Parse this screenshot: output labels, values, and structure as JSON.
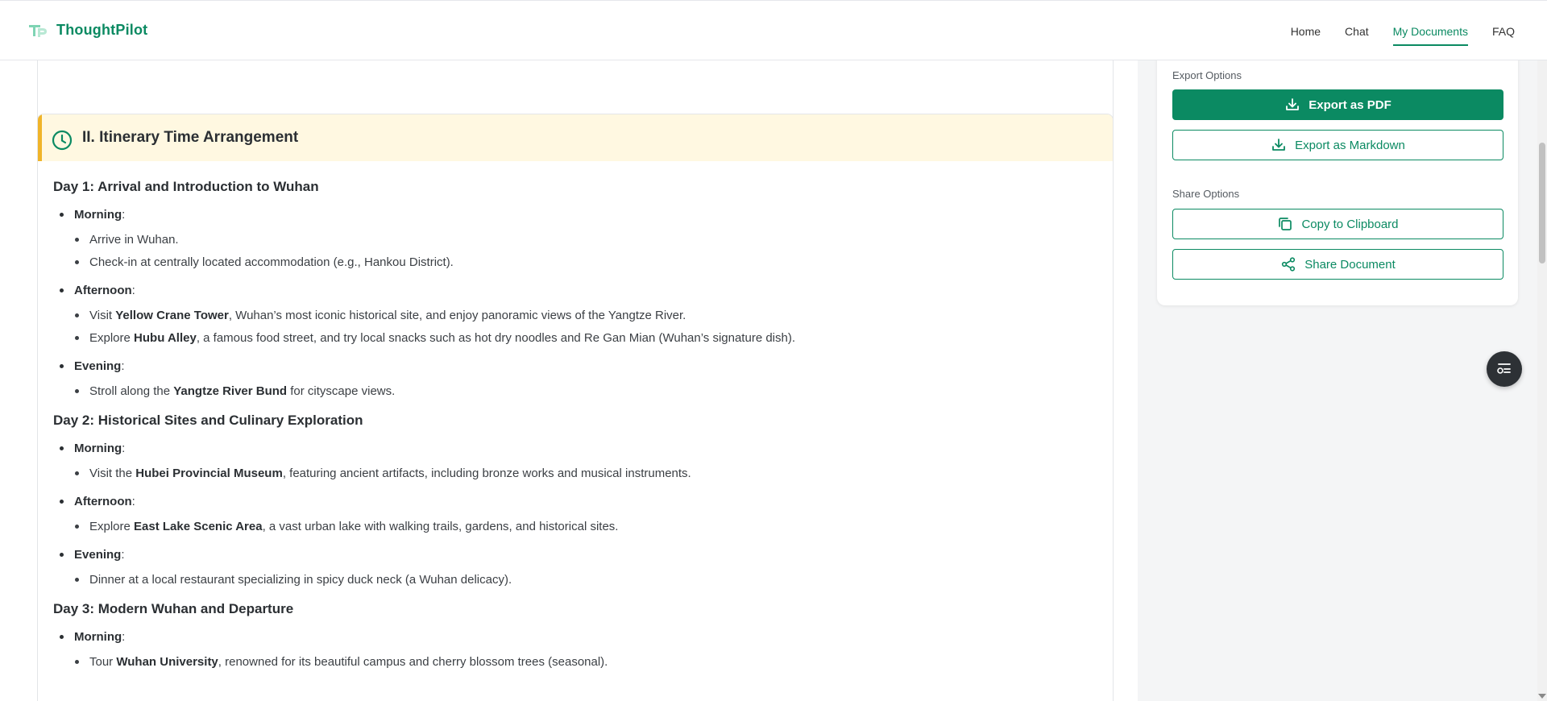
{
  "brand": {
    "name": "ThoughtPilot"
  },
  "nav": {
    "items": [
      "Home",
      "Chat",
      "My Documents",
      "FAQ"
    ],
    "active": "My Documents"
  },
  "section": {
    "title": "II. Itinerary Time Arrangement",
    "days": [
      {
        "title": "Day 1: Arrival and Introduction to Wuhan",
        "morning_label": "Morning",
        "morning": [
          "Arrive in Wuhan.",
          "Check-in at centrally located accommodation (e.g., Hankou District)."
        ],
        "afternoon_label": "Afternoon",
        "afternoon_1_pre": "Visit ",
        "afternoon_1_bold": "Yellow Crane Tower",
        "afternoon_1_post": ", Wuhan’s most iconic historical site, and enjoy panoramic views of the Yangtze River.",
        "afternoon_2_pre": "Explore ",
        "afternoon_2_bold": "Hubu Alley",
        "afternoon_2_post": ", a famous food street, and try local snacks such as hot dry noodles and Re Gan Mian (Wuhan’s signature dish).",
        "evening_label": "Evening",
        "evening_1_pre": "Stroll along the ",
        "evening_1_bold": "Yangtze River Bund",
        "evening_1_post": " for cityscape views."
      },
      {
        "title": "Day 2: Historical Sites and Culinary Exploration",
        "morning_label": "Morning",
        "morning_1_pre": "Visit the ",
        "morning_1_bold": "Hubei Provincial Museum",
        "morning_1_post": ", featuring ancient artifacts, including bronze works and musical instruments.",
        "afternoon_label": "Afternoon",
        "afternoon_1_pre": "Explore ",
        "afternoon_1_bold": "East Lake Scenic Area",
        "afternoon_1_post": ", a vast urban lake with walking trails, gardens, and historical sites.",
        "evening_label": "Evening",
        "evening_1": "Dinner at a local restaurant specializing in spicy duck neck (a Wuhan delicacy)."
      },
      {
        "title": "Day 3: Modern Wuhan and Departure",
        "morning_label": "Morning",
        "morning_1_pre": "Tour ",
        "morning_1_bold": "Wuhan University",
        "morning_1_post": ", renowned for its beautiful campus and cherry blossom trees (seasonal)."
      }
    ]
  },
  "sidebar": {
    "export_label": "Export Options",
    "export_pdf": "Export as PDF",
    "export_md": "Export as Markdown",
    "share_label": "Share Options",
    "copy": "Copy to Clipboard",
    "share": "Share Document"
  },
  "colors": {
    "accent": "#0b8a62",
    "highlight_bg": "#fff8e1",
    "highlight_border": "#f0b429"
  },
  "icons": [
    "logo-icon",
    "clock-icon",
    "download-icon",
    "copy-icon",
    "share-icon",
    "toc-icon"
  ]
}
